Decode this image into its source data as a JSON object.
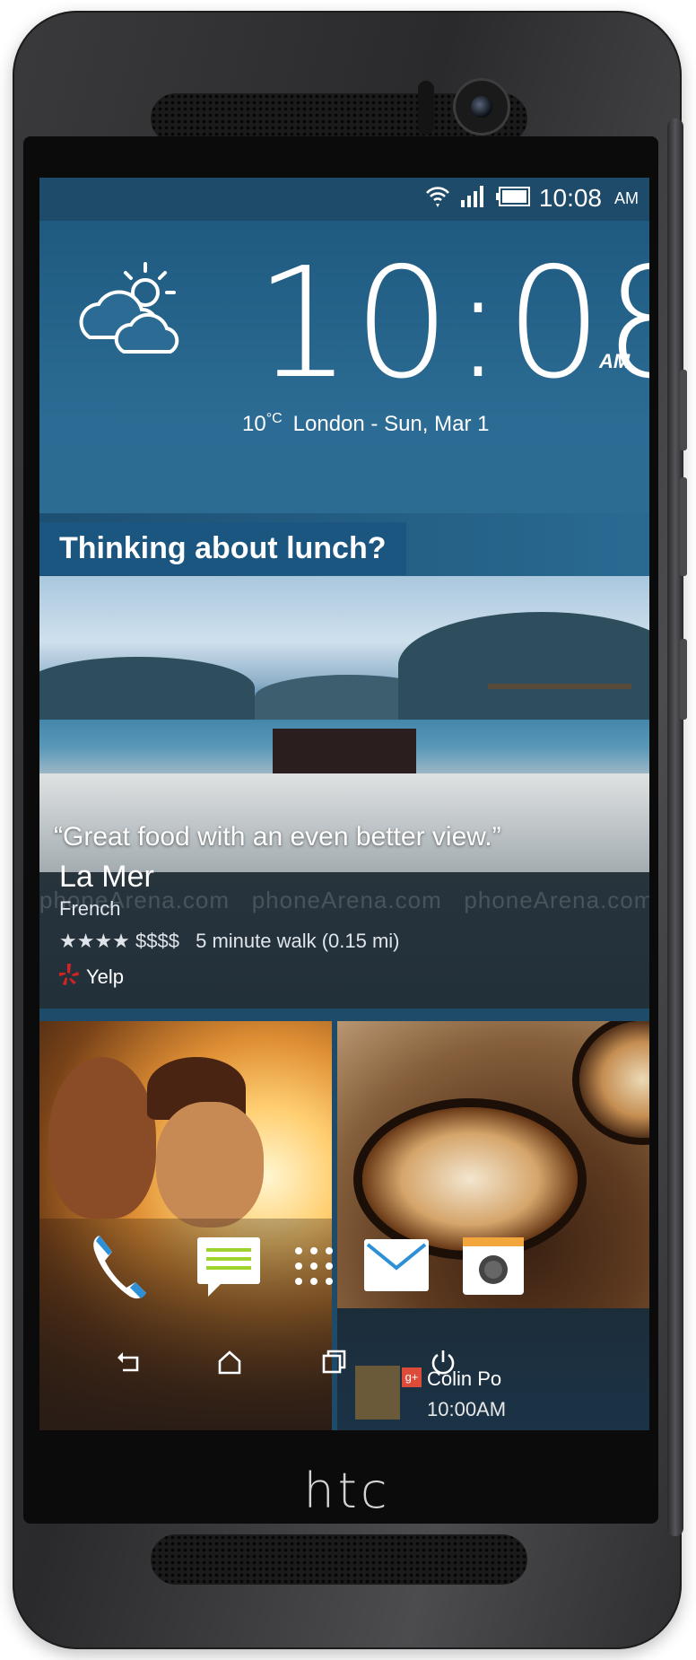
{
  "device": {
    "brand_logo": "htc"
  },
  "status_bar": {
    "time": "10:08",
    "ampm": "AM",
    "icons": [
      "wifi-icon",
      "signal-icon",
      "battery-icon"
    ]
  },
  "weather_widget": {
    "clock_time": "10:08",
    "clock_ampm": "AM",
    "temperature": "10",
    "temperature_unit": "°C",
    "location_date": "London - Sun, Mar 1",
    "condition_icon": "partly-cloudy-icon"
  },
  "blinkfeed_card": {
    "title": "Thinking about lunch?",
    "quote": "“Great food with an even better view.”",
    "venue_name": "La Mer",
    "cuisine": "French",
    "stars": "★★★★",
    "price": "$$$$",
    "distance": "5 minute walk (0.15 mi)",
    "source": "Yelp"
  },
  "notification_tile": {
    "name": "Colin Po",
    "time": "10:00AM",
    "source_icon": "google-plus-icon"
  },
  "watermark": "phoneArena.com",
  "dock": [
    {
      "name": "phone-app-icon"
    },
    {
      "name": "messages-app-icon"
    },
    {
      "name": "app-drawer-icon"
    },
    {
      "name": "mail-app-icon"
    },
    {
      "name": "camera-app-icon"
    }
  ],
  "nav_bar": [
    "back-icon",
    "home-icon",
    "recent-apps-icon",
    "power-icon"
  ],
  "colors": {
    "card_title_bg": "#1b5680",
    "weather_bg": "#2c6c94",
    "yelp_red": "#d32323",
    "mail_blue": "#2d8fd6",
    "camera_orange": "#f3a63b",
    "messages_green": "#9fd32d"
  }
}
